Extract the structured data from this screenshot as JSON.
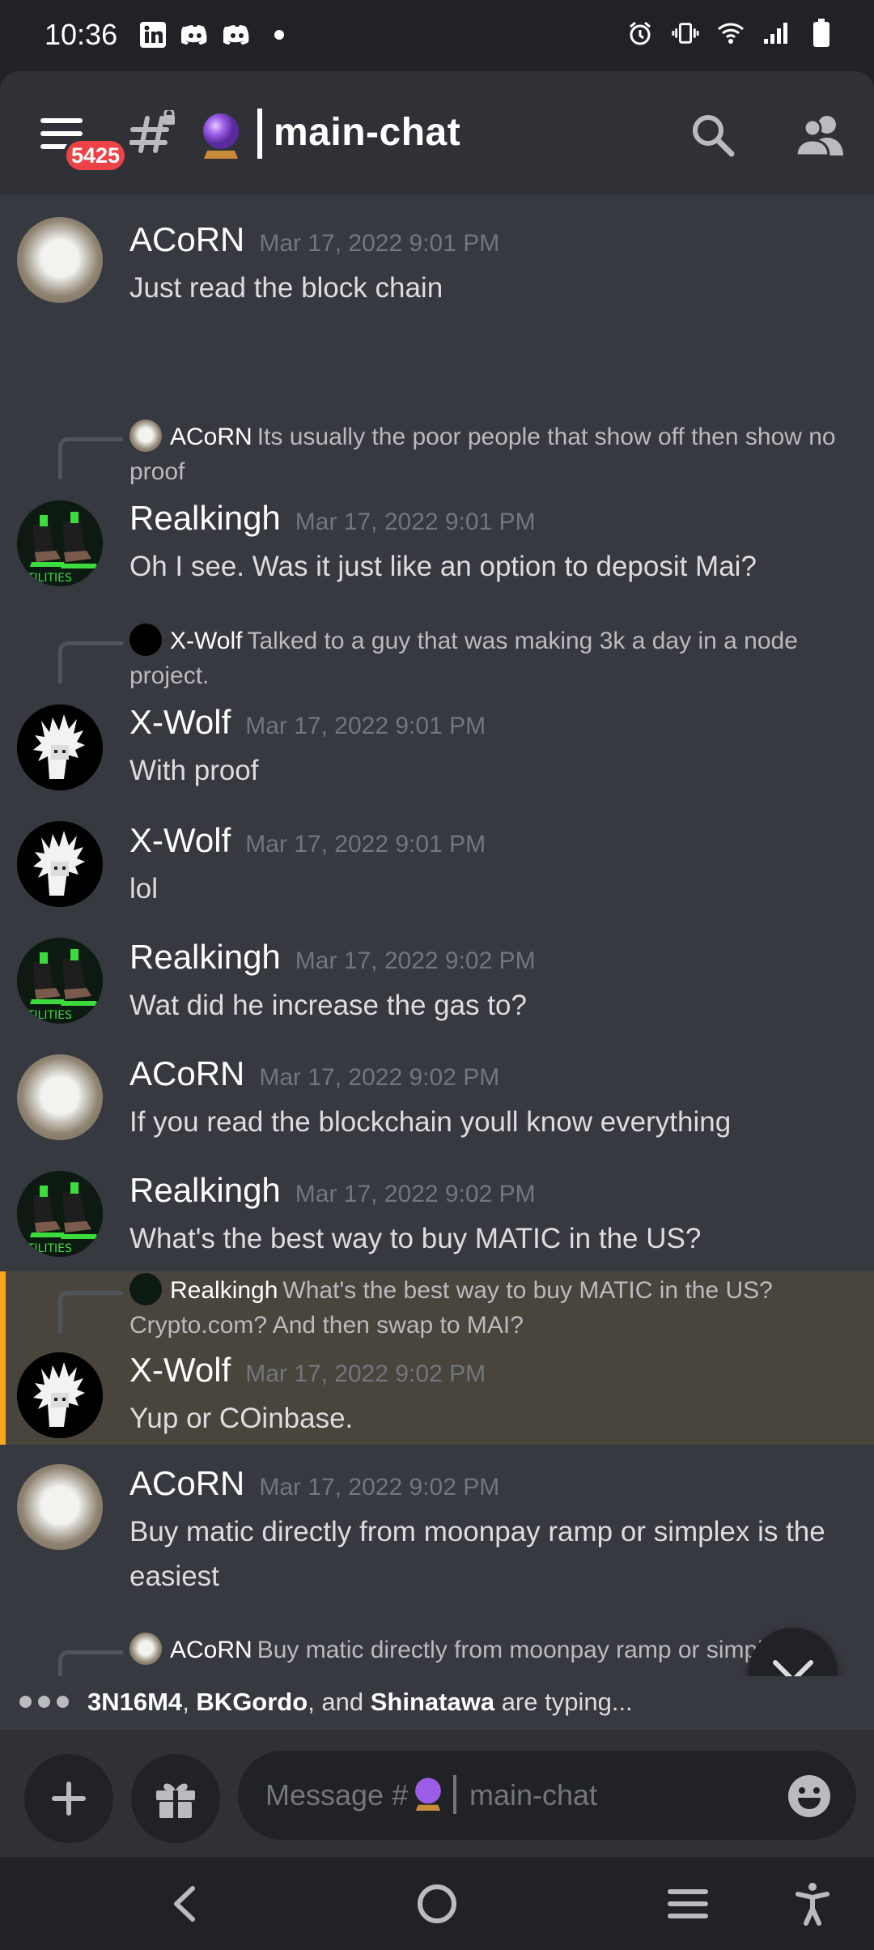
{
  "status_bar": {
    "time": "10:36",
    "left_icons": [
      "linkedin-icon",
      "discord-icon",
      "discord-icon",
      "dot-icon"
    ],
    "right_icons": [
      "alarm-icon",
      "vibrate-icon",
      "wifi-icon",
      "signal-icon",
      "battery-icon"
    ]
  },
  "header": {
    "notification_count": "5425",
    "channel_name": "main-chat",
    "channel_emoji": "crystal-ball-icon"
  },
  "messages": [
    {
      "author": "ACoRN",
      "timestamp": "Mar 17, 2022 9:01 PM",
      "text": "Just read the block chain",
      "avatar": "dog"
    },
    {
      "reply_to": {
        "author": "ACoRN",
        "text": "Its usually the poor people that show off then show no proof",
        "avatar": "dog"
      },
      "author": "Realkingh",
      "timestamp": "Mar 17, 2022 9:01 PM",
      "text": "Oh I see. Was it just like an option to deposit Mai?",
      "avatar": "shoes"
    },
    {
      "reply_to": {
        "author": "X-Wolf",
        "text": "Talked to a guy that was making 3k a day in a node project.",
        "avatar": "wolf"
      },
      "author": "X-Wolf",
      "timestamp": "Mar 17, 2022 9:01 PM",
      "text": "With proof",
      "avatar": "wolf"
    },
    {
      "author": "X-Wolf",
      "timestamp": "Mar 17, 2022 9:01 PM",
      "text": "lol",
      "avatar": "wolf"
    },
    {
      "author": "Realkingh",
      "timestamp": "Mar 17, 2022 9:02 PM",
      "text": "Wat did he increase the gas to?",
      "avatar": "shoes"
    },
    {
      "author": "ACoRN",
      "timestamp": "Mar 17, 2022 9:02 PM",
      "text": "If you read the blockchain youll know everything",
      "avatar": "dog"
    },
    {
      "author": "Realkingh",
      "timestamp": "Mar 17, 2022 9:02 PM",
      "text": "What's the best way to buy MATIC in the US? Crypto.com? And then swap to MAI?",
      "avatar": "shoes"
    },
    {
      "reply_to": {
        "author": "Realkingh",
        "text": "What's the best way to buy MATIC in the US? Crypto.com? And then swap to MAI?",
        "avatar": "shoes"
      },
      "author": "X-Wolf",
      "timestamp": "Mar 17, 2022 9:02 PM",
      "text": "Yup or COinbase.",
      "avatar": "wolf",
      "highlighted": true
    },
    {
      "author": "ACoRN",
      "timestamp": "Mar 17, 2022 9:02 PM",
      "text": "Buy matic directly from moonpay ramp or simplex is the easiest",
      "avatar": "dog"
    },
    {
      "reply_to": {
        "author": "ACoRN",
        "text": "Buy matic directly from moonpay ramp or simplex is",
        "avatar": "dog"
      }
    }
  ],
  "typing": {
    "user1": "3N16M4",
    "sep1": ", ",
    "user2": "BKGordo",
    "sep2": ", and ",
    "user3": "Shinatawa",
    "suffix": " are typing..."
  },
  "composer": {
    "placeholder_prefix": "Message #",
    "placeholder_channel": "main-chat"
  },
  "colors": {
    "background": "#36393f",
    "header": "#2f3136",
    "mention_highlight": "#49443c",
    "mention_bar": "#faa61a",
    "badge": "#ed4245"
  }
}
